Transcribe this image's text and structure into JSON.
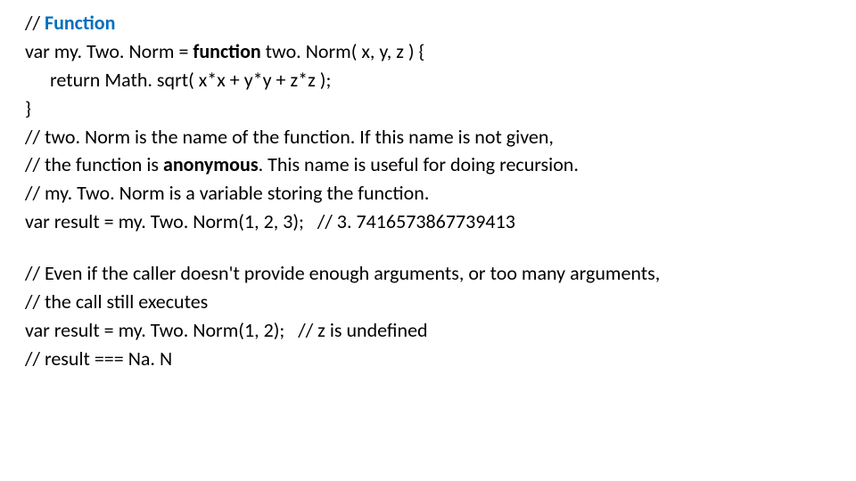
{
  "lines": {
    "l1a": "// ",
    "l1b": "Function",
    "l2a": "var my. Two. Norm = ",
    "l2b": "function",
    "l2c": " two. Norm( x, y, z ) {",
    "l3": "return Math. sqrt( x*x + y*y + z*z );",
    "l4": "}",
    "l5": "// two. Norm is the name of the function. If this name is not given,",
    "l6a": "// the function is ",
    "l6b": "anonymous",
    "l6c": ". This name is useful for doing recursion.",
    "l7": "// my. Two. Norm is a variable storing the function.",
    "l8": "var result = my. Two. Norm(1, 2, 3);   // 3. 7416573867739413",
    "l9": "// Even if the caller doesn't provide enough arguments, or too many arguments,",
    "l10": "// the call still executes",
    "l11": "var result = my. Two. Norm(1, 2);   // z is undefined",
    "l12": "// result === Na. N"
  }
}
